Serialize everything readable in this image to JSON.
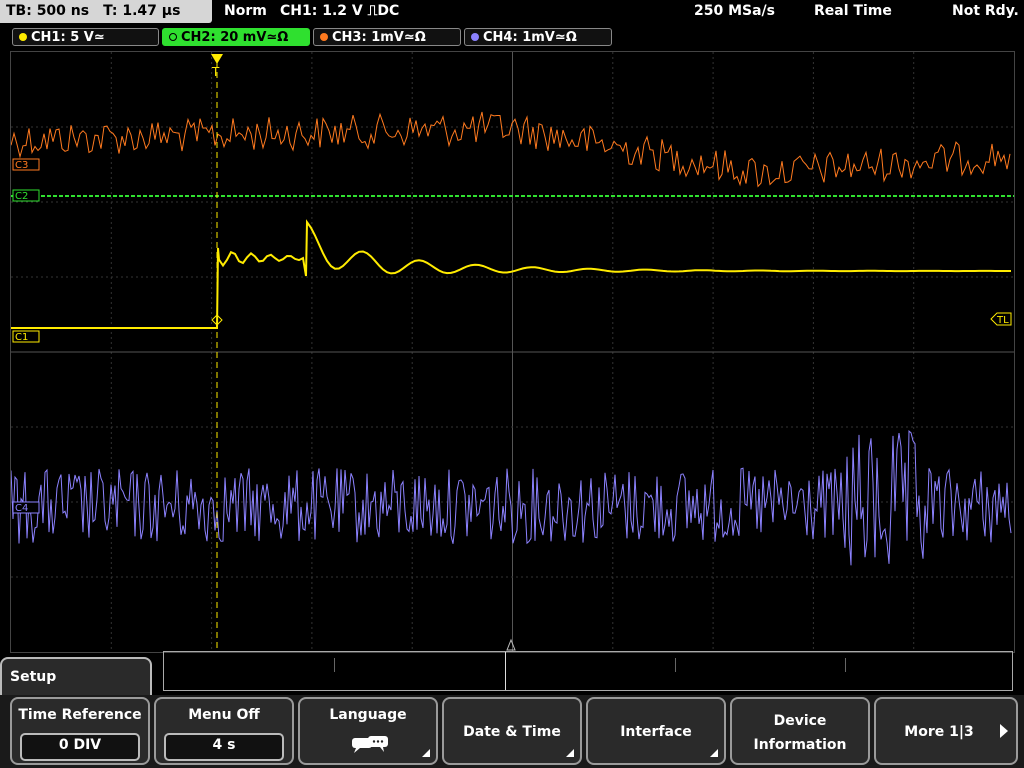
{
  "topbar": {
    "timebase": "TB: 500 ns",
    "trigger_time": "T: 1.47 µs",
    "mode": "Norm",
    "trigger": "CH1: 1.2 V ⎍DC",
    "sample_rate": "250 MSa/s",
    "acq_mode": "Real Time",
    "status": "Not Rdy."
  },
  "channels": [
    {
      "label": "CH1: 5 V≃",
      "color": "#ffeb00"
    },
    {
      "label": "CH2: 20 mV≃Ω",
      "color": "#2fe02f"
    },
    {
      "label": "CH3: 1mV≃Ω",
      "color": "#ff7a1f"
    },
    {
      "label": "CH4: 1mV≃Ω",
      "color": "#8c82ff"
    }
  ],
  "screen": {
    "markers": {
      "c3": "C3",
      "c2": "C2",
      "c1": "C1",
      "c4": "C4",
      "tl": "TL"
    }
  },
  "setup": {
    "title": "Setup"
  },
  "softkeys": [
    {
      "label": "Time Reference",
      "value": "0 DIV"
    },
    {
      "label": "Menu Off",
      "value": "4 s"
    },
    {
      "label": "Language",
      "icon": "speech-bubble-icon"
    },
    {
      "label": "Date & Time"
    },
    {
      "label": "Interface"
    },
    {
      "label": "Device",
      "label2": "Information"
    },
    {
      "label": "More 1|3"
    }
  ]
}
